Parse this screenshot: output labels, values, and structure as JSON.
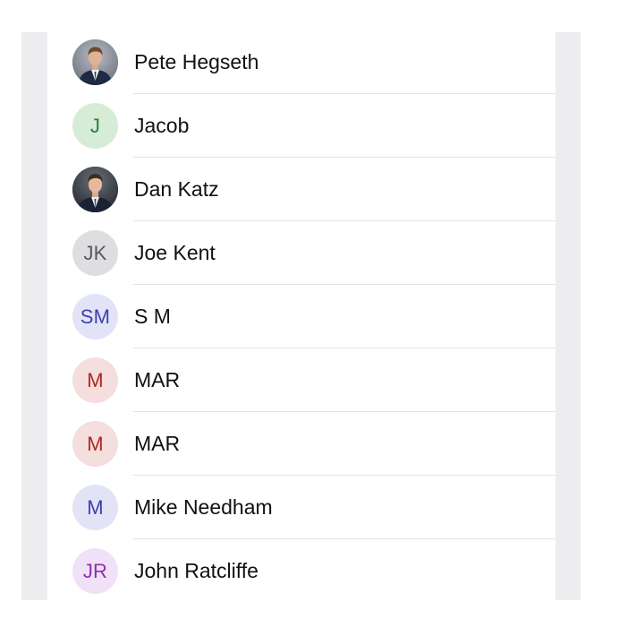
{
  "contacts": [
    {
      "name": "Pete Hegseth",
      "avatar": {
        "type": "photo",
        "icon": "person-photo-icon"
      }
    },
    {
      "name": "Jacob",
      "avatar": {
        "type": "initials",
        "initials": "J",
        "bg": "#d6ecd6",
        "fg": "#2f7d34"
      }
    },
    {
      "name": "Dan Katz",
      "avatar": {
        "type": "photo",
        "icon": "person-photo-icon"
      }
    },
    {
      "name": "Joe Kent",
      "avatar": {
        "type": "initials",
        "initials": "JK",
        "bg": "#dedee0",
        "fg": "#5a5a5e"
      }
    },
    {
      "name": "S M",
      "avatar": {
        "type": "initials",
        "initials": "SM",
        "bg": "#e3e3f8",
        "fg": "#3d3fae"
      }
    },
    {
      "name": "MAR",
      "avatar": {
        "type": "initials",
        "initials": "M",
        "bg": "#f4dede",
        "fg": "#b3261e"
      }
    },
    {
      "name": "MAR",
      "avatar": {
        "type": "initials",
        "initials": "M",
        "bg": "#f4dede",
        "fg": "#b3261e"
      }
    },
    {
      "name": "Mike Needham",
      "avatar": {
        "type": "initials",
        "initials": "M",
        "bg": "#e3e3f8",
        "fg": "#3d3fae"
      }
    },
    {
      "name": "John Ratcliffe",
      "avatar": {
        "type": "initials",
        "initials": "JR",
        "bg": "#f1e1f6",
        "fg": "#8e2fb3"
      }
    }
  ]
}
